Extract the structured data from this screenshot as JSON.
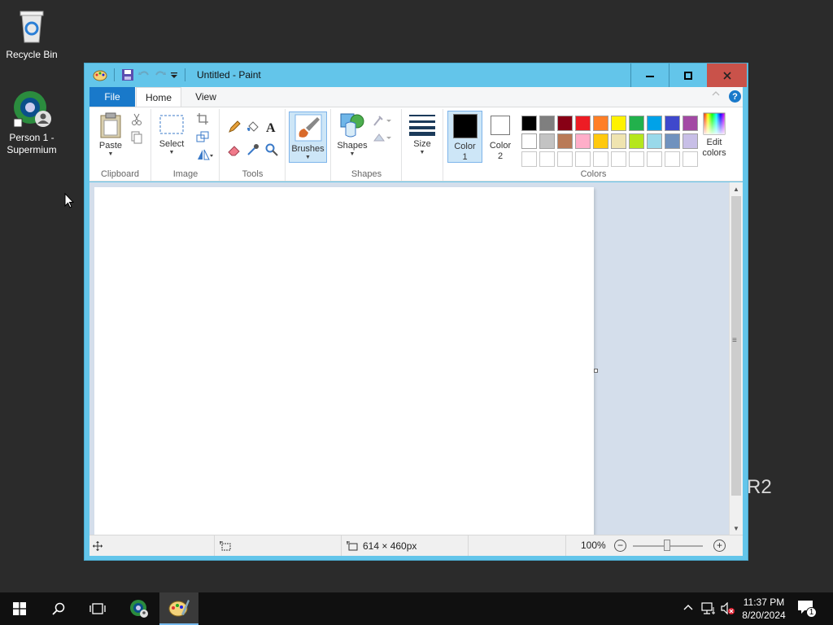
{
  "desktop": {
    "icons": [
      {
        "label": "Recycle Bin"
      },
      {
        "label": "Person 1 -\nSupermium"
      }
    ],
    "watermark": "R2"
  },
  "window": {
    "title": "Untitled - Paint",
    "buttons": {
      "minimize": "—",
      "maximize": "☐",
      "close": "✕"
    }
  },
  "tabs": {
    "file": "File",
    "home": "Home",
    "view": "View",
    "help": "?"
  },
  "ribbon": {
    "clipboard": {
      "label": "Clipboard",
      "paste": "Paste"
    },
    "image": {
      "label": "Image",
      "select": "Select"
    },
    "tools": {
      "label": "Tools"
    },
    "brushes": {
      "label": "Brushes"
    },
    "shapes": {
      "label": "Shapes",
      "shapes_btn": "Shapes"
    },
    "size": {
      "label": "Size"
    },
    "colors": {
      "label": "Colors",
      "color1": "Color\n1",
      "color2": "Color\n2",
      "edit_colors": "Edit\ncolors",
      "palette_row1": [
        "#000000",
        "#7f7f7f",
        "#880015",
        "#ed1c24",
        "#ff7f27",
        "#fff200",
        "#22b14c",
        "#00a2e8",
        "#3f48cc",
        "#a349a4"
      ],
      "palette_row2": [
        "#ffffff",
        "#c3c3c3",
        "#b97a57",
        "#ffaec9",
        "#ffc90e",
        "#efe4b0",
        "#b5e61d",
        "#99d9ea",
        "#7092be",
        "#c8bfe7"
      ]
    }
  },
  "statusbar": {
    "canvas_size": "614 × 460px",
    "zoom": "100%"
  },
  "taskbar": {
    "time": "11:37 PM",
    "date": "8/20/2024",
    "notifications": "1"
  }
}
